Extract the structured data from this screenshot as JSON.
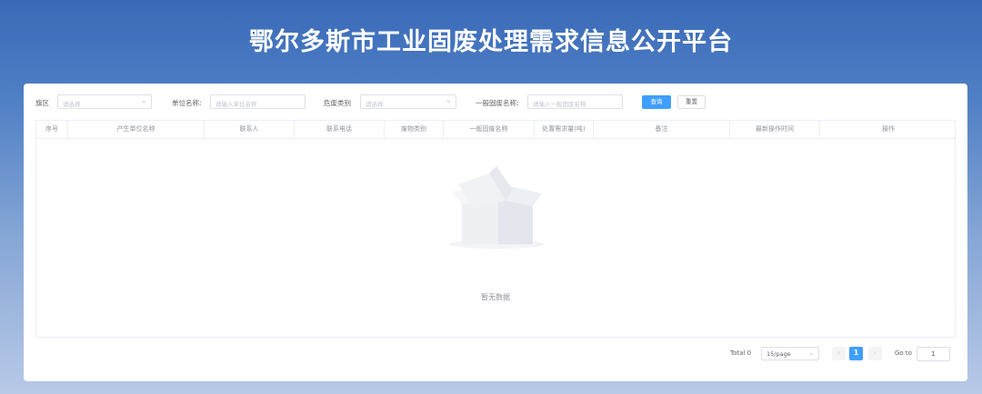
{
  "header": {
    "title": "鄂尔多斯市工业固废处理需求信息公开平台"
  },
  "filters": {
    "district": {
      "label": "旗区",
      "placeholder": "请选择"
    },
    "unit_name": {
      "label": "单位名称:",
      "placeholder": "请输入单位名称"
    },
    "hazard_type": {
      "label": "危废类别",
      "placeholder": "请选择"
    },
    "waste_name": {
      "label": "一般固废名称:",
      "placeholder": "请输入一般固废名称"
    },
    "query_label": "查询",
    "reset_label": "重置"
  },
  "table": {
    "columns": [
      "序号",
      "产生单位名称",
      "联系人",
      "联系电话",
      "废物类别",
      "一般固废名称",
      "处置需求量(吨)",
      "备注",
      "最新操作时间",
      "操作"
    ],
    "empty_text": "暂无数据"
  },
  "pagination": {
    "total": "Total 0",
    "page_size": "15/page",
    "prev": "‹",
    "current_page": "1",
    "next": "›",
    "goto_label": "Go to",
    "goto_value": "1"
  },
  "colors": {
    "primary": "#409eff",
    "header_bg": "#3a6ab8"
  },
  "icons": {
    "chevron": "chevron-down-icon",
    "empty": "empty-box-icon"
  }
}
